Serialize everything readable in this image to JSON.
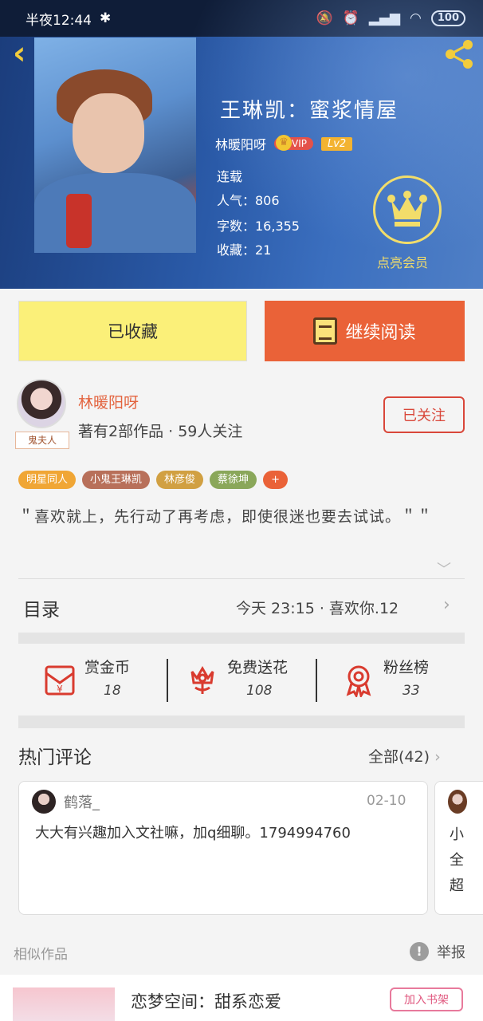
{
  "status_bar": {
    "time": "半夜12:44",
    "battery": "100"
  },
  "book": {
    "title": "王琳凯：蜜浆情屋",
    "author": "林暖阳呀",
    "vip_label": "VIP",
    "level": "Lv2",
    "status": "连载",
    "popularity": "人气：806",
    "word_count": "字数：16,355",
    "favorites": "收藏：21",
    "member_label": "点亮会员"
  },
  "actions": {
    "collected_label": "已收藏",
    "read_label": "继续阅读"
  },
  "author_panel": {
    "avatar_tag": "鬼夫人",
    "name": "林暖阳呀",
    "stats": "著有2部作品 · 59人关注",
    "follow_label": "已关注"
  },
  "tags": [
    {
      "label": "明星同人",
      "color": "#f0a635"
    },
    {
      "label": "小鬼王琳凯",
      "color": "#b8705a"
    },
    {
      "label": "林彦俊",
      "color": "#d1a042"
    },
    {
      "label": "蔡徐坤",
      "color": "#8aa75a"
    },
    {
      "label": "+",
      "color": "#ea6238"
    }
  ],
  "intro": "＂喜欢就上，先行动了再考虑，即使很迷也要去试试。＂＂",
  "toc": {
    "title": "目录",
    "latest": "今天 23:15 · 喜欢你.12"
  },
  "stats": [
    {
      "label": "赏金币",
      "value": "18",
      "icon": "red-envelope-icon"
    },
    {
      "label": "免费送花",
      "value": "108",
      "icon": "flower-icon"
    },
    {
      "label": "粉丝榜",
      "value": "33",
      "icon": "award-ribbon-icon"
    }
  ],
  "comments": {
    "title": "热门评论",
    "all_label": "全部(42)",
    "items": [
      {
        "user": "鹤落_",
        "date": "02-10",
        "text": "大大有兴趣加入文社嘛，加q细聊。1794994760"
      }
    ],
    "second_card_lines": [
      "小",
      "全",
      "超"
    ]
  },
  "bottom": {
    "similar_label": "相似作品",
    "report_label": "举报",
    "rec_title": "恋梦空间：甜系恋爱",
    "add_shelf_label": "加入书架"
  },
  "colors": {
    "accent_orange": "#ea6238",
    "accent_yellow": "#fbf079",
    "vip_gold": "#f2dd6a"
  }
}
